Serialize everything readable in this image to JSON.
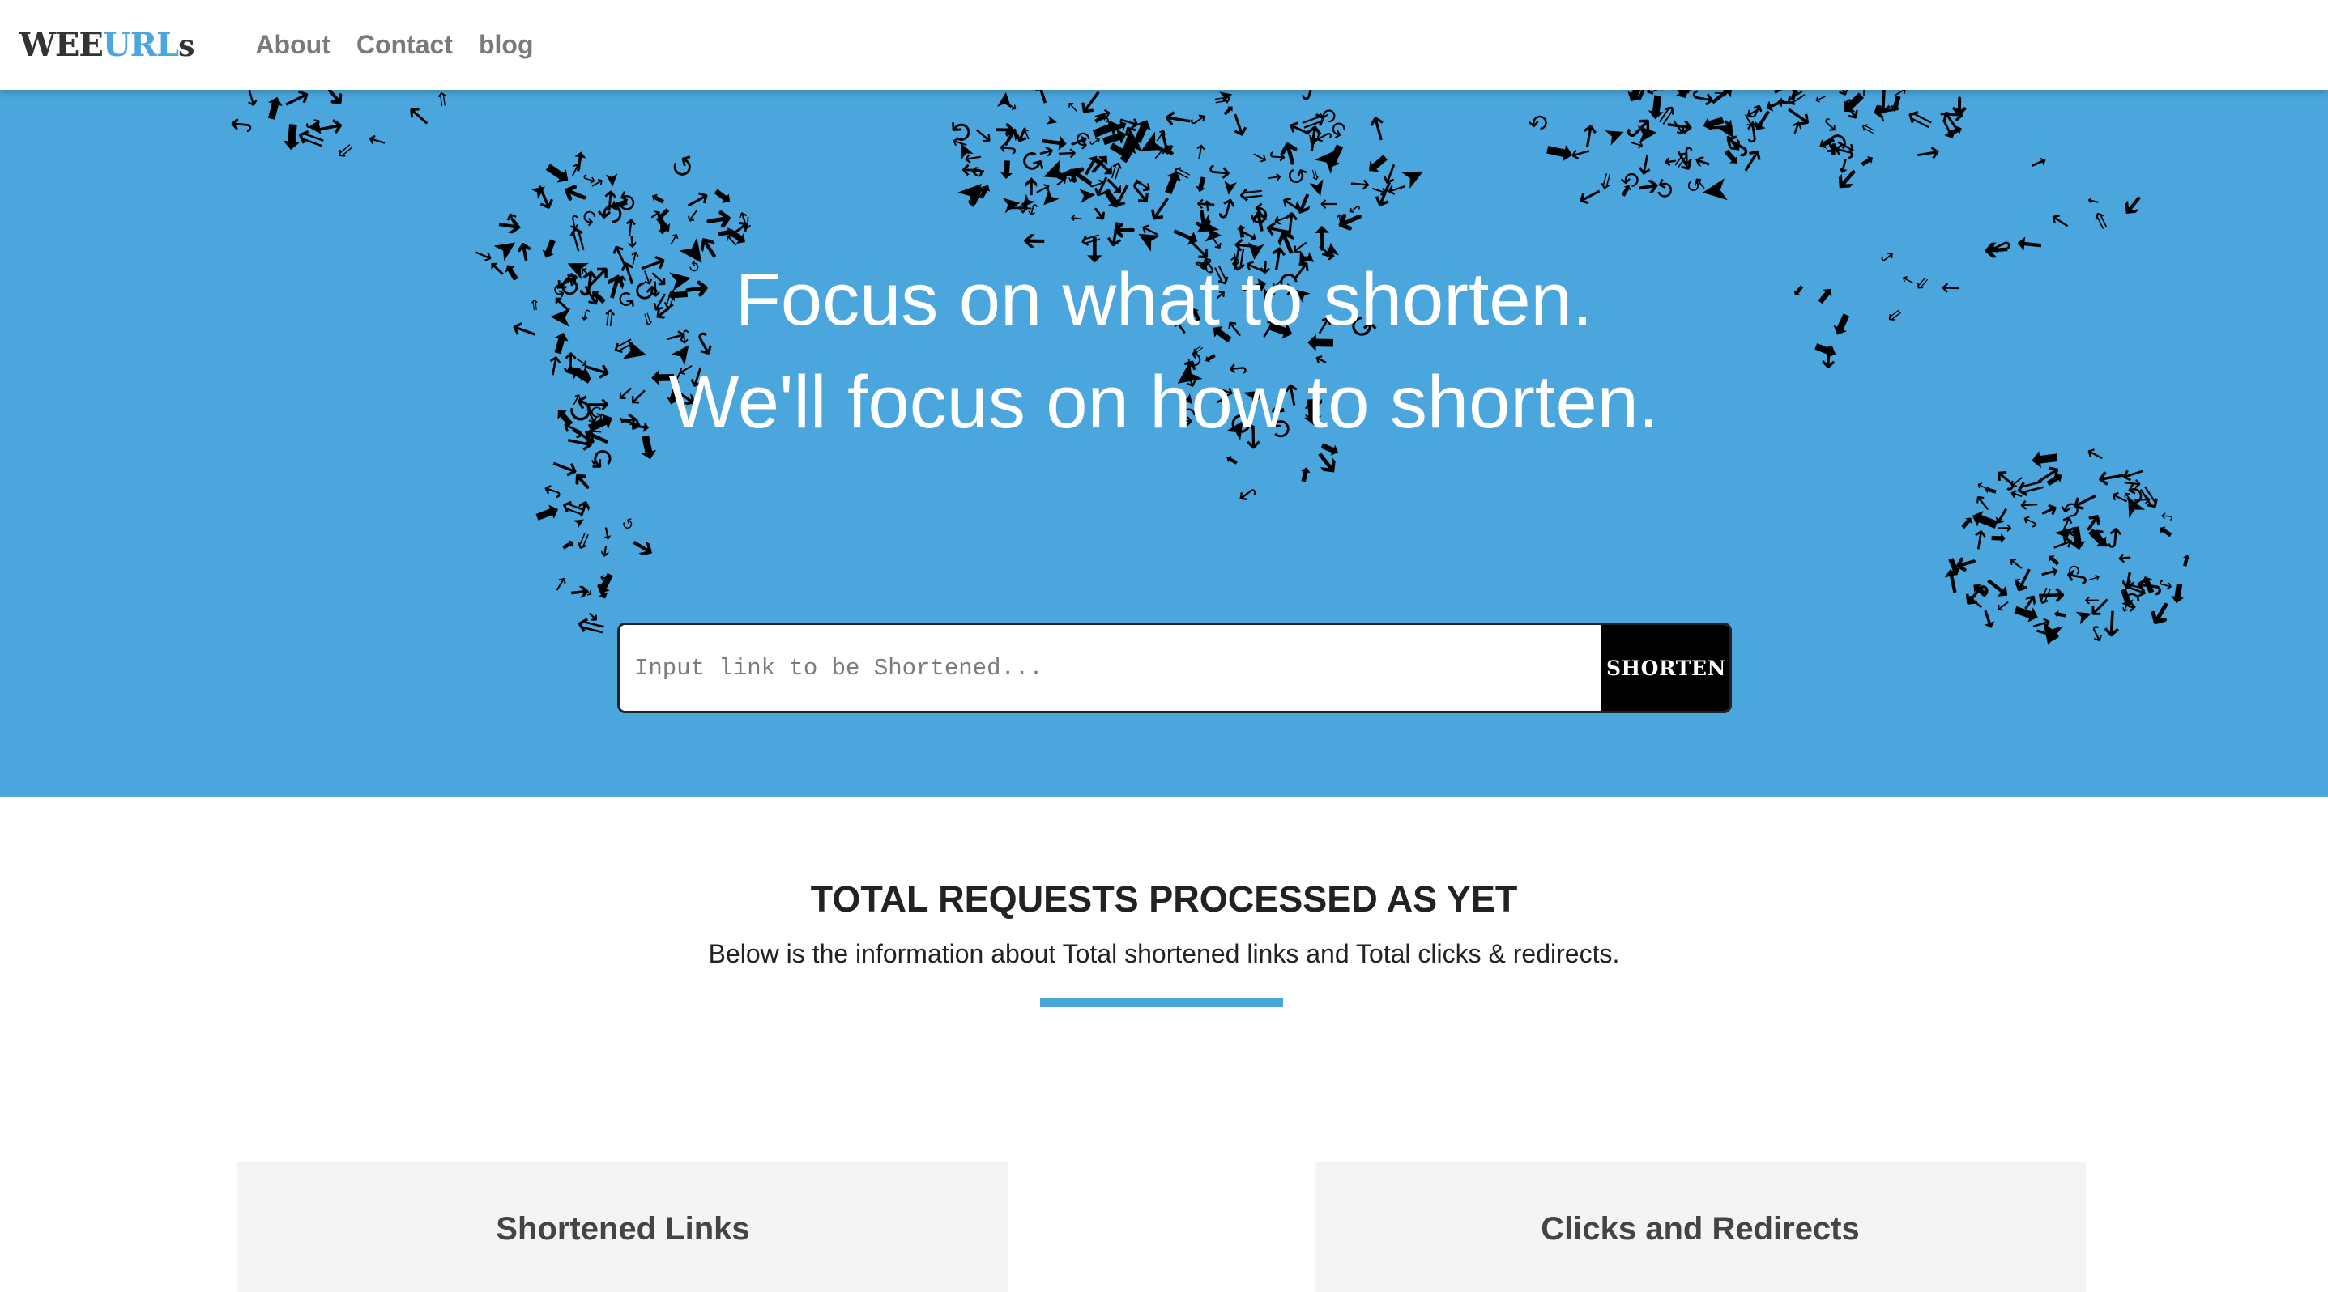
{
  "nav": {
    "logo": {
      "part1": "WEE",
      "part2": "URL",
      "part3": "s"
    },
    "links": [
      "About",
      "Contact",
      "blog"
    ]
  },
  "hero": {
    "title_line1": "Focus on what to shorten.",
    "title_line2": "We'll focus on how to shorten.",
    "search": {
      "placeholder": "Input link to be Shortened...",
      "value": ""
    },
    "button_label": "SHORTEN",
    "background_icon": "world-map-of-arrows"
  },
  "stats": {
    "title": "TOTAL REQUESTS PROCESSED AS YET",
    "subtitle": "Below is the information about Total shortened links and Total clicks & redirects.",
    "cards": [
      {
        "title": "Shortened Links"
      },
      {
        "title": "Clicks and Redirects"
      }
    ]
  },
  "colors": {
    "accent": "#4aa6dd",
    "hero_bg": "#4aa6dd",
    "button_bg": "#000000",
    "card_bg": "#f4f4f4",
    "text_dark": "#222222",
    "nav_text": "#7a7a7a"
  }
}
